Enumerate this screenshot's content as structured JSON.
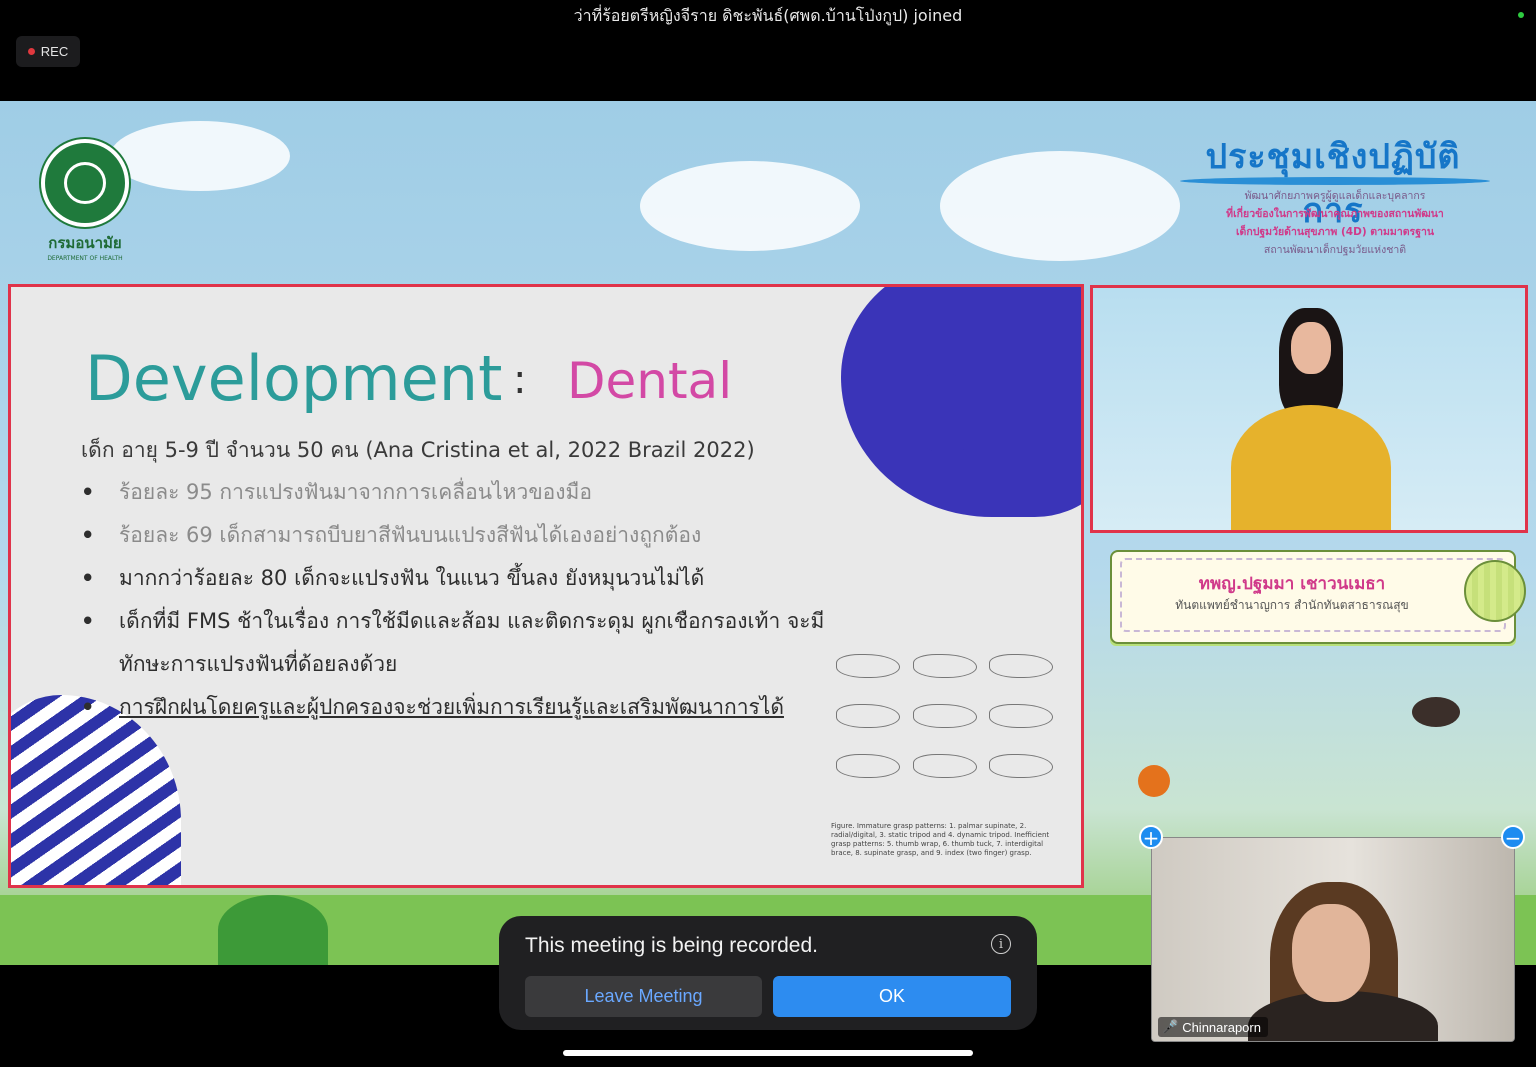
{
  "notification": {
    "join_text": "ว่าที่ร้อยตรีหญิงจีราย ดิชะพันธ์(ศพด.บ้านโป่งกูป) joined"
  },
  "recording": {
    "rec_label": "REC"
  },
  "stage": {
    "logo": {
      "name_th": "กรมอนามัย",
      "name_en": "DEPARTMENT OF HEALTH"
    },
    "header": {
      "title": "ประชุมเชิงปฏิบัติการ",
      "lines": [
        "พัฒนาศักยภาพครูผู้ดูแลเด็กและบุคลากร",
        "ที่เกี่ยวข้องในการพัฒนาคุณภาพของสถานพัฒนา",
        "เด็กปฐมวัยด้านสุขภาพ (4D) ตามมาตรฐาน",
        "สถานพัฒนาเด็กปฐมวัยแห่งชาติ"
      ]
    },
    "slide": {
      "title": "Development",
      "colon": ":",
      "subtitle": "Dental",
      "intro": "เด็ก อายุ 5-9 ปี จำนวน 50 คน  (Ana Cristina et al, 2022 Brazil 2022)",
      "bullets": [
        "ร้อยละ 95 การแปรงฟันมาจากการเคลื่อนไหวของมือ",
        "ร้อยละ 69 เด็กสามารถบีบยาสีฟันบนแปรงสีฟันได้เองอย่างถูกต้อง",
        "มากกว่าร้อยละ 80 เด็กจะแปรงฟัน ในแนว ขึ้นลง ยังหมุนวนไม่ได้",
        "เด็กที่มี FMS ช้าในเรื่อง การใช้มีดและส้อม และติดกระดุม ผูกเชือกรองเท้า จะมี",
        "การฝึกฝนโดยครูและผู้ปกครองจะช่วยเพิ่มการเรียนรู้และเสริมพัฒนาการได้"
      ],
      "continuation": "ทักษะการแปรงฟันที่ด้อยลงด้วย",
      "bullet_char": "•",
      "figure_caption": "Figure. Immature grasp patterns: 1. palmar supinate, 2. radial/digital, 3. static tripod and 4. dynamic tripod. Inefficient grasp patterns: 5. thumb wrap, 6. thumb tuck, 7. interdigital brace, 8. supinate grasp, and 9. index (two finger) grasp."
    },
    "speaker_card": {
      "name": "ทพญ.ปฐมมา เชาวนเมธา",
      "title": "ทันตแพทย์ชำนาญการ สำนักทันตสาธารณสุข"
    }
  },
  "self_view": {
    "participant_name": "Chinnaraporn",
    "add_symbol": "+",
    "remove_symbol": "−",
    "mic_symbol": "🎤"
  },
  "record_dialog": {
    "message": "This meeting is being recorded.",
    "info_symbol": "i",
    "leave_label": "Leave Meeting",
    "ok_label": "OK"
  },
  "colors": {
    "accent_blue": "#2d8cf0",
    "slide_border": "#e0334a",
    "title_teal": "#2c9c9a",
    "subtitle_pink": "#d349a5"
  }
}
